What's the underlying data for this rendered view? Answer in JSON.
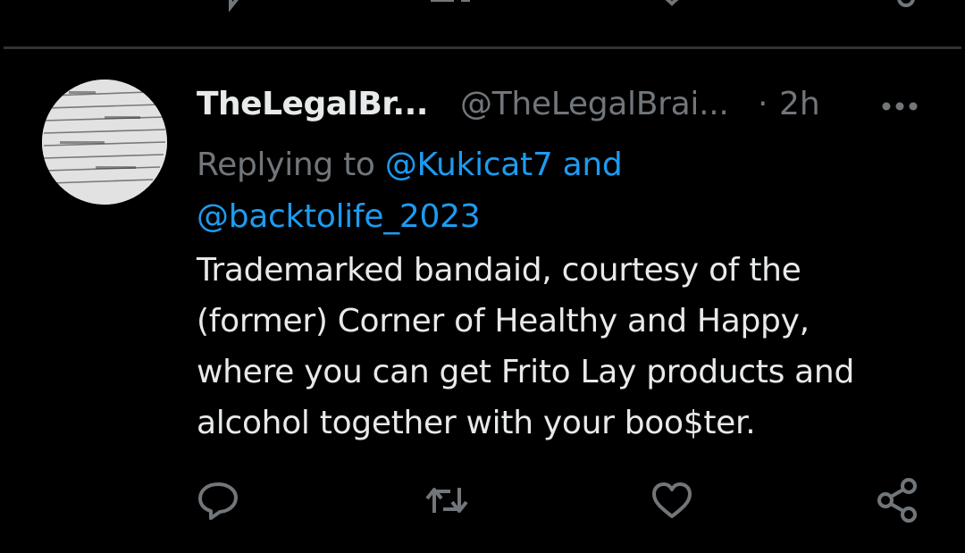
{
  "prev_tweet": {
    "actions": [
      {
        "icon": "reply-icon"
      },
      {
        "icon": "retweet-icon"
      },
      {
        "icon": "like-icon"
      },
      {
        "icon": "share-icon"
      }
    ]
  },
  "tweet": {
    "avatar_icon": "avatar-document-image",
    "display_name": "TheLegalBr...",
    "handle": "@TheLegalBrai...",
    "separator": "·",
    "timestamp": "2h",
    "more_icon": "more-options-icon",
    "replying_to_label": "Replying to ",
    "mention_1": "@Kukicat7",
    "mention_joiner": " and",
    "mention_2": "@backtolife_2023",
    "text": "Trademarked bandaid, courtesy of the\n(former) Corner of Healthy and Happy,\nwhere you can get Frito Lay products and\nalcohol together with your boo$ter.",
    "actions": [
      {
        "icon": "reply-icon"
      },
      {
        "icon": "retweet-icon"
      },
      {
        "icon": "like-icon"
      },
      {
        "icon": "share-icon"
      }
    ]
  },
  "colors": {
    "background": "#000000",
    "text": "#e7e9ea",
    "muted": "#71767b",
    "accent": "#1d9bf0",
    "divider": "#2f3336"
  }
}
